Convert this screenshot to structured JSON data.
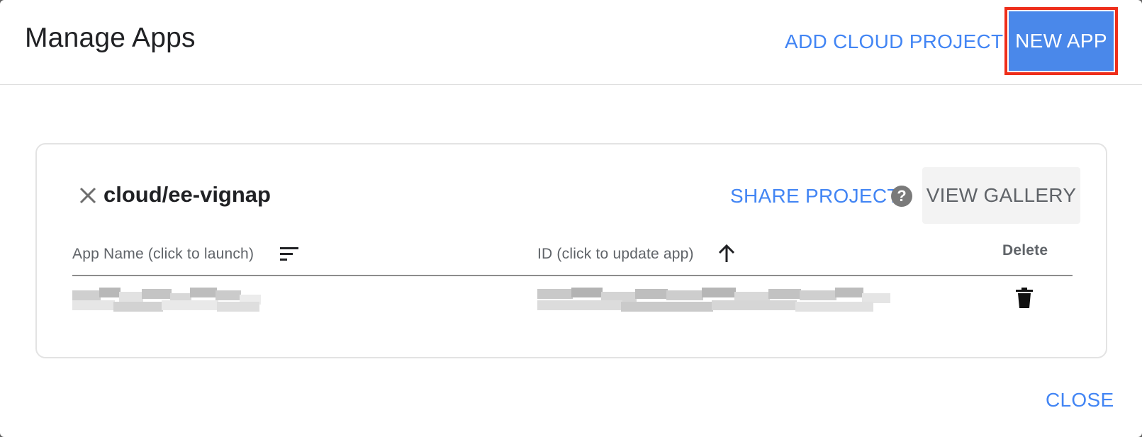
{
  "dialog": {
    "title": "Manage Apps",
    "add_cloud_label": "ADD CLOUD PROJECT",
    "new_app_label": "NEW APP",
    "close_label": "CLOSE"
  },
  "project": {
    "name": "cloud/ee-vignap",
    "share_label": "SHARE PROJECT",
    "help_glyph": "?",
    "view_gallery_label": "VIEW GALLERY"
  },
  "table": {
    "columns": {
      "name": "App Name (click to launch)",
      "id": "ID (click to update app)",
      "delete": "Delete"
    },
    "rows": [
      {
        "name": "",
        "id": "",
        "redacted": true
      }
    ]
  },
  "colors": {
    "accent": "#4285f4",
    "primary_button": "#4a88ea",
    "highlight": "#ee2e1a"
  },
  "icons": [
    "close-icon",
    "help-icon",
    "sort-icon",
    "arrow-up-icon",
    "trash-icon"
  ]
}
